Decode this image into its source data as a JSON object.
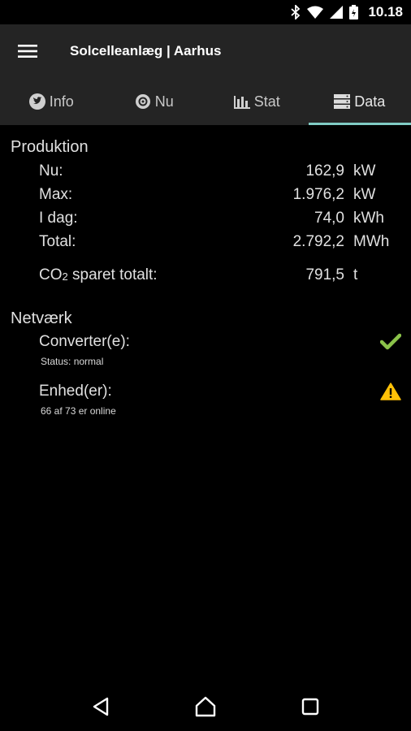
{
  "status_bar": {
    "time": "10.18",
    "icons": [
      "bluetooth-icon",
      "wifi-icon",
      "signal-icon",
      "battery-icon"
    ]
  },
  "toolbar": {
    "title": "Solcelleanlæg | Aarhus",
    "menu_icon": "hamburger-menu-icon"
  },
  "tabs": [
    {
      "label": "Info",
      "icon": "twitter-bird-icon",
      "active": false
    },
    {
      "label": "Nu",
      "icon": "gauge-icon",
      "active": false
    },
    {
      "label": "Stat",
      "icon": "bar-chart-icon",
      "active": false
    },
    {
      "label": "Data",
      "icon": "database-icon",
      "active": true
    }
  ],
  "production": {
    "title": "Produktion",
    "rows": [
      {
        "label": "Nu:",
        "value": "162,9",
        "unit": "kW"
      },
      {
        "label": "Max:",
        "value": "1.976,2",
        "unit": "kW"
      },
      {
        "label": "I dag:",
        "value": "74,0",
        "unit": "kWh"
      },
      {
        "label": "Total:",
        "value": "2.792,2",
        "unit": "MWh"
      }
    ],
    "co2": {
      "label_main": "CO",
      "label_sub": "2",
      "label_rest": " sparet totalt:",
      "value": "791,5",
      "unit": "t"
    }
  },
  "network": {
    "title": "Netværk",
    "items": [
      {
        "label": "Converter(e):",
        "status": "Status: normal",
        "icon": "checkmark-icon",
        "icon_color": "#8bc34a"
      },
      {
        "label": "Enhed(er):",
        "status": "66 af 73 er online",
        "icon": "warning-icon",
        "icon_color": "#ffc107"
      }
    ]
  },
  "nav_bar": {
    "back_icon": "back-triangle-icon",
    "home_icon": "home-icon",
    "recents_icon": "recents-square-icon"
  }
}
